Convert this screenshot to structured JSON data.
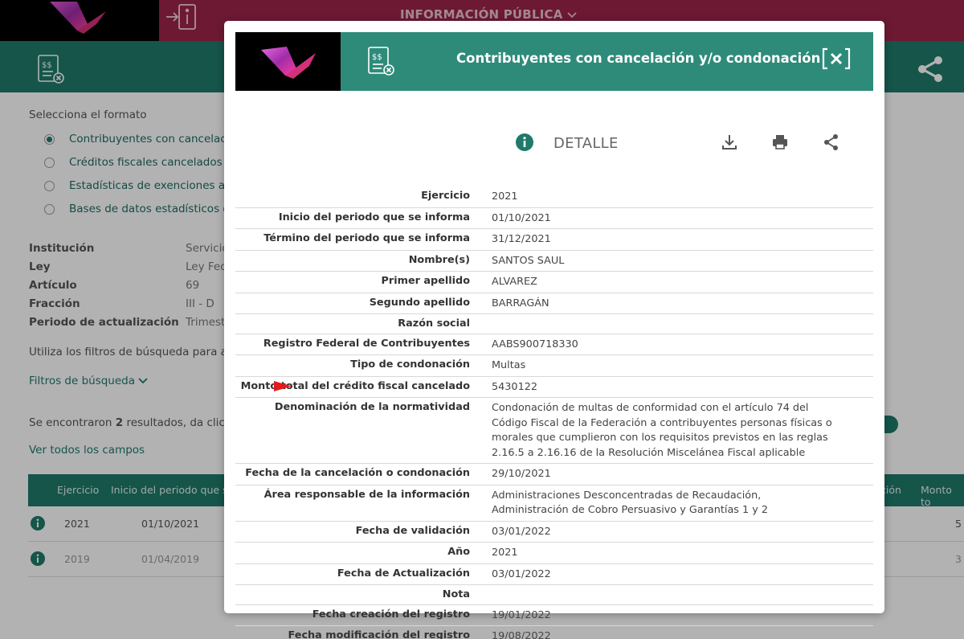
{
  "header": {
    "info_publica": "INFORMACIÓN PÚBLICA"
  },
  "page": {
    "selecciona": "Selecciona el formato",
    "formatos": [
      {
        "label": "Contribuyentes con cancelación",
        "checked": true
      },
      {
        "label": "Créditos fiscales cancelados o co",
        "checked": false
      },
      {
        "label": "Estadísticas de exenciones a créd",
        "checked": false
      },
      {
        "label": "Bases de datos estadísticos de ca",
        "checked": false
      }
    ],
    "meta": [
      {
        "k": "Institución",
        "v": "Servicio"
      },
      {
        "k": "Ley",
        "v": "Ley Fede"
      },
      {
        "k": "Artículo",
        "v": "69"
      },
      {
        "k": "Fracción",
        "v": "III - D"
      },
      {
        "k": "Periodo de actualización",
        "v": "Trimestr"
      }
    ],
    "utiliza": "Utiliza los filtros de búsqueda para acota",
    "filtros": "Filtros de búsqueda",
    "resultados_pre": "Se encontraron ",
    "resultados_num": "2",
    "resultados_post": " resultados, da clic en",
    "ver_todos": "Ver todos los campos",
    "table_headers": [
      "Ejercicio",
      "Inicio del periodo que s...",
      "ción",
      "Monto to"
    ],
    "rows": [
      {
        "ejercicio": "2021",
        "inicio": "01/10/2021",
        "monto": "5"
      },
      {
        "ejercicio": "2019",
        "inicio": "01/04/2019",
        "monto": "3"
      }
    ]
  },
  "modal": {
    "title": "Contribuyentes con cancelación y/o condonación",
    "detalle": "DETALLE",
    "rows": [
      {
        "label": "Ejercicio",
        "value": "2021"
      },
      {
        "label": "Inicio del periodo que se informa",
        "value": "01/10/2021"
      },
      {
        "label": "Término del periodo que se informa",
        "value": "31/12/2021"
      },
      {
        "label": "Nombre(s)",
        "value": "SANTOS SAUL"
      },
      {
        "label": "Primer apellido",
        "value": "ALVAREZ"
      },
      {
        "label": "Segundo apellido",
        "value": "BARRAGÁN"
      },
      {
        "label": "Razón social",
        "value": ""
      },
      {
        "label": "Registro Federal de Contribuyentes",
        "value": "AABS900718330"
      },
      {
        "label": "Tipo de condonación",
        "value": "Multas"
      },
      {
        "label": "Monto total del crédito fiscal cancelado",
        "value": "5430122",
        "highlight": true
      },
      {
        "label": "Denominación de la normatividad",
        "value": "Condonación de multas de conformidad con el artículo 74 del Código Fiscal de la Federación a contribuyentes personas físicas o morales que cumplieron con los requisitos previstos en las reglas 2.16.5 a 2.16.16 de la Resolución Miscelánea Fiscal aplicable"
      },
      {
        "label": "Fecha de la cancelación o condonación",
        "value": "29/10/2021"
      },
      {
        "label": "Área responsable de la información",
        "value": "Administraciones Desconcentradas de Recaudación, Administración de Cobro Persuasivo y Garantías 1 y 2"
      },
      {
        "label": "Fecha de validación",
        "value": "03/01/2022"
      },
      {
        "label": "Año",
        "value": "2021"
      },
      {
        "label": "Fecha de Actualización",
        "value": "03/01/2022"
      },
      {
        "label": "Nota",
        "value": ""
      },
      {
        "label": "Fecha creación del registro",
        "value": "19/01/2022"
      },
      {
        "label": "Fecha modificación del registro",
        "value": "19/08/2022"
      }
    ]
  },
  "colors": {
    "brand": "#9d2449",
    "teal": "#1f7a6b",
    "modal_header": "#2e8b7a",
    "arrow": "#e41b1b"
  },
  "icons": {
    "info": "info-icon",
    "download": "download-icon",
    "print": "print-icon",
    "share": "share-icon",
    "close": "close-icon",
    "document": "document-icon"
  }
}
